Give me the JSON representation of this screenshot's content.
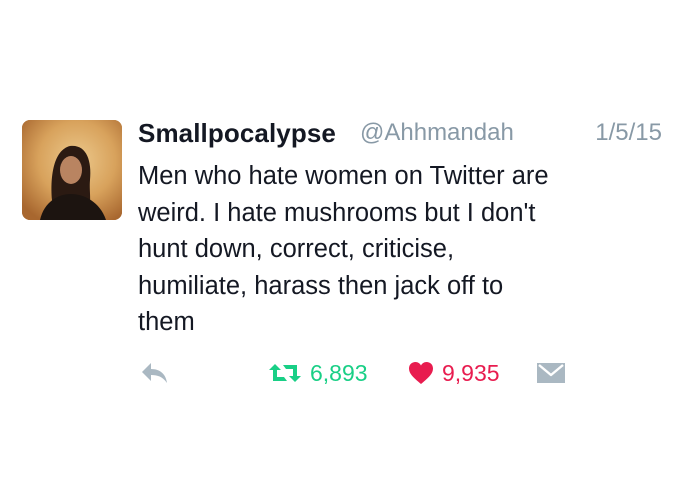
{
  "tweet": {
    "display_name": "Smallpocalypse",
    "handle": "@Ahhmandah",
    "date": "1/5/15",
    "text": "Men who hate women on Twitter are\nweird. I hate mushrooms but I don't\nhunt down, correct, criticise,\nhumiliate, harass then jack off to\nthem",
    "retweet_count": "6,893",
    "like_count": "9,935"
  },
  "icons": {
    "reply": "reply-arrow-icon",
    "retweet": "retweet-icon",
    "like": "heart-icon",
    "dm": "envelope-icon"
  },
  "colors": {
    "text": "#141823",
    "muted": "#8899a6",
    "icon_gray": "#aab8c2",
    "retweet_green": "#19cf86",
    "like_red": "#e81c4f"
  }
}
